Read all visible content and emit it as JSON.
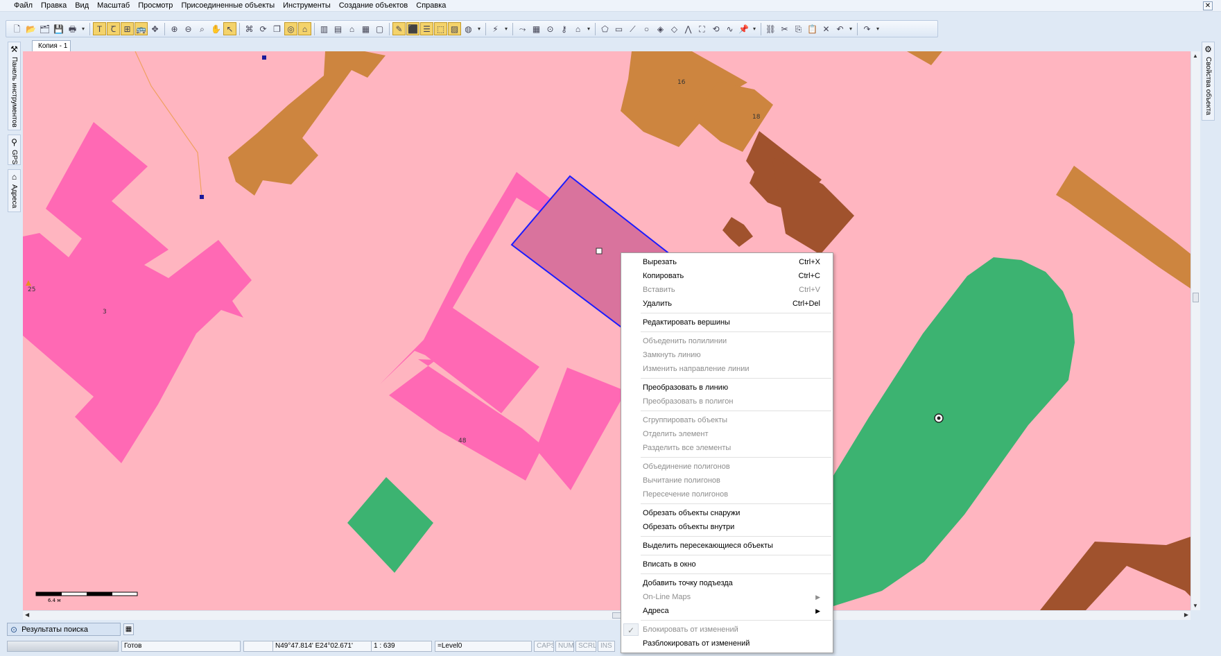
{
  "menubar": {
    "items": [
      "Файл",
      "Правка",
      "Вид",
      "Масштаб",
      "Просмотр",
      "Присоединенные объекты",
      "Инструменты",
      "Создание объектов",
      "Справка"
    ],
    "close_label": "✕"
  },
  "toolbar": {
    "buttons": [
      {
        "icon": "new-file-icon",
        "glyph": "🗋"
      },
      {
        "icon": "open-folder-icon",
        "glyph": "📂"
      },
      {
        "icon": "open-map-icon",
        "glyph": "🗂"
      },
      {
        "icon": "save-icon",
        "glyph": "💾"
      },
      {
        "icon": "print-icon",
        "glyph": "🖶"
      },
      {
        "icon": "text-tool-icon",
        "glyph": "T",
        "active": true
      },
      {
        "icon": "text-edit-icon",
        "glyph": "Ꞇ",
        "active": true
      },
      {
        "icon": "grid-snap-icon",
        "glyph": "⊞",
        "active": true
      },
      {
        "icon": "bus-icon",
        "glyph": "🚌",
        "active": true
      },
      {
        "icon": "move-icon",
        "glyph": "✥"
      },
      {
        "icon": "zoom-in-icon",
        "glyph": "⊕"
      },
      {
        "icon": "zoom-out-icon",
        "glyph": "⊖"
      },
      {
        "icon": "zoom-area-icon",
        "glyph": "⌕"
      },
      {
        "icon": "pan-hand-icon",
        "glyph": "✋"
      },
      {
        "icon": "select-pointer-icon",
        "glyph": "↖",
        "active": true
      },
      {
        "icon": "node-edit-icon",
        "glyph": "⌘"
      },
      {
        "icon": "rotate-icon",
        "glyph": "⟳"
      },
      {
        "icon": "layers-icon",
        "glyph": "❐"
      },
      {
        "icon": "overlap-icon",
        "glyph": "◎",
        "active": true
      },
      {
        "icon": "house-edit-icon",
        "glyph": "⌂",
        "active": true
      },
      {
        "icon": "barcode-icon",
        "glyph": "▥"
      },
      {
        "icon": "building-list-icon",
        "glyph": "▤"
      },
      {
        "icon": "house-icon",
        "glyph": "⌂"
      },
      {
        "icon": "bar-chart-icon",
        "glyph": "▦"
      },
      {
        "icon": "frame-icon",
        "glyph": "▢"
      },
      {
        "icon": "tag-icon",
        "glyph": "✎",
        "active": true
      },
      {
        "icon": "green-select-icon",
        "glyph": "⬛",
        "active": true
      },
      {
        "icon": "green-list-icon",
        "glyph": "☰",
        "active": true
      },
      {
        "icon": "green-chart-icon",
        "glyph": "⬚",
        "active": true
      },
      {
        "icon": "green-graph-icon",
        "glyph": "▨",
        "active": true
      },
      {
        "icon": "globe-icon",
        "glyph": "◍"
      },
      {
        "icon": "lightning-icon",
        "glyph": "⚡"
      },
      {
        "icon": "route-icon",
        "glyph": "⤳"
      },
      {
        "icon": "table-icon",
        "glyph": "▦"
      },
      {
        "icon": "binoculars-icon",
        "glyph": "⊙"
      },
      {
        "icon": "key-icon",
        "glyph": "⚷"
      },
      {
        "icon": "home-marker-icon",
        "glyph": "⌂"
      },
      {
        "icon": "pentagon-icon",
        "glyph": "⬠"
      },
      {
        "icon": "rectangle-icon",
        "glyph": "▭"
      },
      {
        "icon": "ruler-icon",
        "glyph": "⟋"
      },
      {
        "icon": "circle-icon",
        "glyph": "○"
      },
      {
        "icon": "diamond-fill-icon",
        "glyph": "◈"
      },
      {
        "icon": "diamond-icon",
        "glyph": "◇"
      },
      {
        "icon": "polyline-icon",
        "glyph": "⋀"
      },
      {
        "icon": "bounding-box-icon",
        "glyph": "⛶"
      },
      {
        "icon": "rotate-shape-icon",
        "glyph": "⟲"
      },
      {
        "icon": "curve-icon",
        "glyph": "∿"
      },
      {
        "icon": "pin-icon",
        "glyph": "📌"
      },
      {
        "icon": "link-icon",
        "glyph": "⛓"
      },
      {
        "icon": "cut-icon",
        "glyph": "✂"
      },
      {
        "icon": "copy-icon",
        "glyph": "⎘"
      },
      {
        "icon": "paste-icon",
        "glyph": "📋"
      },
      {
        "icon": "delete-icon",
        "glyph": "✕"
      },
      {
        "icon": "undo-icon",
        "glyph": "↶"
      },
      {
        "icon": "redo-icon",
        "glyph": "↷"
      }
    ]
  },
  "left_tabs": [
    {
      "label": "Панель инструментов",
      "icon": "toolbox-icon",
      "glyph": "⚒"
    },
    {
      "label": "GPS",
      "icon": "gps-icon",
      "glyph": "⚲"
    },
    {
      "label": "Адреса",
      "icon": "address-icon",
      "glyph": "⌂"
    }
  ],
  "right_tab": {
    "label": "Свойства объекта",
    "icon": "properties-icon",
    "glyph": "⚙"
  },
  "document_tab": "Копия - 1",
  "map": {
    "background": "#ffb5c0",
    "labels": [
      "16",
      "18",
      "25",
      "3",
      "48"
    ],
    "scale_label": "6.4 м"
  },
  "search_panel": {
    "label": "Результаты поиска"
  },
  "status": {
    "state": "Готов",
    "coords": "N49°47.814' E24°02.671'",
    "scale": "1 : 639",
    "level": "=Level0",
    "indicators": [
      "CAPS",
      "NUM",
      "SCRL",
      "INS"
    ]
  },
  "context_menu": {
    "groups": [
      [
        {
          "label": "Вырезать",
          "shortcut": "Ctrl+X",
          "enabled": true
        },
        {
          "label": "Копировать",
          "shortcut": "Ctrl+C",
          "enabled": true
        },
        {
          "label": "Вставить",
          "shortcut": "Ctrl+V",
          "enabled": false
        },
        {
          "label": "Удалить",
          "shortcut": "Ctrl+Del",
          "enabled": true
        }
      ],
      [
        {
          "label": "Редактировать вершины",
          "enabled": true
        }
      ],
      [
        {
          "label": "Объеденить полилинии",
          "enabled": false
        },
        {
          "label": "Замкнуть линию",
          "enabled": false
        },
        {
          "label": "Изменить направление линии",
          "enabled": false
        }
      ],
      [
        {
          "label": "Преобразовать в линию",
          "enabled": true
        },
        {
          "label": "Преобразовать в полигон",
          "enabled": false
        }
      ],
      [
        {
          "label": "Сгруппировать объекты",
          "enabled": false
        },
        {
          "label": "Отделить элемент",
          "enabled": false
        },
        {
          "label": "Разделить все элементы",
          "enabled": false
        }
      ],
      [
        {
          "label": "Объединение полигонов",
          "enabled": false
        },
        {
          "label": "Вычитание полигонов",
          "enabled": false
        },
        {
          "label": "Пересечение полигонов",
          "enabled": false
        }
      ],
      [
        {
          "label": "Обрезать объекты снаружи",
          "enabled": true
        },
        {
          "label": "Обрезать объекты внутри",
          "enabled": true
        }
      ],
      [
        {
          "label": "Выделить пересекающиеся объекты",
          "enabled": true
        }
      ],
      [
        {
          "label": "Вписать в окно",
          "enabled": true
        }
      ],
      [
        {
          "label": "Добавить точку подъезда",
          "enabled": true
        },
        {
          "label": "On-Line Maps",
          "enabled": false,
          "submenu": true
        },
        {
          "label": "Адреса",
          "enabled": true,
          "submenu": true
        }
      ],
      [
        {
          "label": "Блокировать от изменений",
          "enabled": false,
          "checked": true
        },
        {
          "label": "Разблокировать от изменений",
          "enabled": true
        }
      ]
    ]
  }
}
